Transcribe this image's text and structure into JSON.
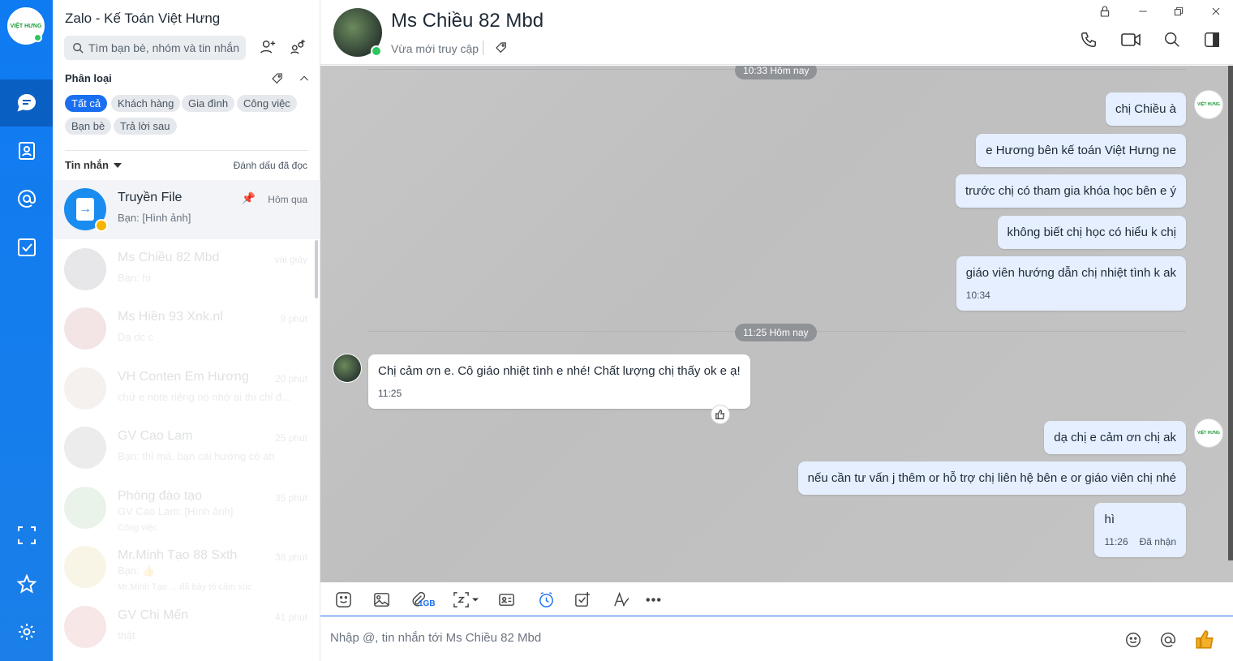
{
  "app": {
    "title": "Zalo - Kế Toán Việt Hưng",
    "avatar_text": "VIỆT HƯNG"
  },
  "sidebar": {
    "search_placeholder": "Tìm bạn bè, nhóm và tin nhắn",
    "category_title": "Phân loại",
    "chips": [
      "Tất cả",
      "Khách hàng",
      "Gia đình",
      "Công việc",
      "Bạn bè",
      "Trả lời sau"
    ],
    "messages_label": "Tin nhắn",
    "mark_read": "Đánh dấu đã đọc",
    "conversations": [
      {
        "name": "Truyền File",
        "snippet": "Bạn: [Hình ảnh]",
        "time": "Hôm qua",
        "pinned": true
      },
      {
        "name": "Ms Chiều 82 Mbd",
        "snippet": "Bạn: hì",
        "time": "vài giây"
      },
      {
        "name": "Ms Hiền 93 Xnk.nl",
        "snippet": "Dạ dc c",
        "time": "9 phút"
      },
      {
        "name": "VH Conten Em Hương",
        "snippet": "chứ e note riêng nó nhớ ai thì chỉ đ...",
        "time": "20 phút"
      },
      {
        "name": "GV Cao Lam",
        "snippet": "Bạn: thì mà. bạn cái hướng có ah",
        "time": "25 phút"
      },
      {
        "name": "Phòng đào tạo",
        "snippet": "GV Cao Lam: [Hình ảnh]",
        "time": "35 phút",
        "tag": "Công việc"
      },
      {
        "name": "Mr.Minh Tạo 88 Sxth",
        "snippet": "Bạn: 👍",
        "time": "38 phút",
        "tag": "Mr.Minh Tạo ... đã bày tỏ cảm xúc"
      },
      {
        "name": "GV Chi Mến",
        "snippet": "thật",
        "time": "41 phút"
      }
    ]
  },
  "chat": {
    "name": "Ms Chiều 82 Mbd",
    "status": "Vừa mới truy cập",
    "timestamps": [
      "10:33 Hôm nay",
      "11:25 Hôm nay"
    ],
    "messages": [
      {
        "text": "chị Chiều à"
      },
      {
        "text": "e Hương bên kế toán Việt Hưng ne"
      },
      {
        "text": "trước chị có tham gia khóa học bên e ý"
      },
      {
        "text": "không biết chị học có hiểu k chị"
      },
      {
        "text": "giáo viên hướng dẫn chị nhiệt tình k ak",
        "time": "10:34"
      },
      {
        "text": "Chị cảm ơn e. Cô giáo nhiệt tình e nhé! Chất lượng chị thấy ok e ạ!",
        "time": "11:25"
      },
      {
        "text": "dạ chị e cảm ơn chị ak"
      },
      {
        "text": "nếu cần tư vấn j thêm or hỗ trợ chị liên hệ bên e or giáo viên chị nhé"
      },
      {
        "text": "hì",
        "time": "11:26",
        "status": "Đã nhận"
      }
    ],
    "me_avatar_text": "VIỆT HƯNG"
  },
  "toolbar": {
    "file_limit": "1GB"
  },
  "compose": {
    "placeholder": "Nhập @, tin nhắn tới Ms Chiều 82 Mbd"
  },
  "colors": {
    "rail": "#0f7bf2",
    "accent": "#1a6ff0",
    "bubble_out": "#e5efff",
    "online": "#2cc55f"
  }
}
